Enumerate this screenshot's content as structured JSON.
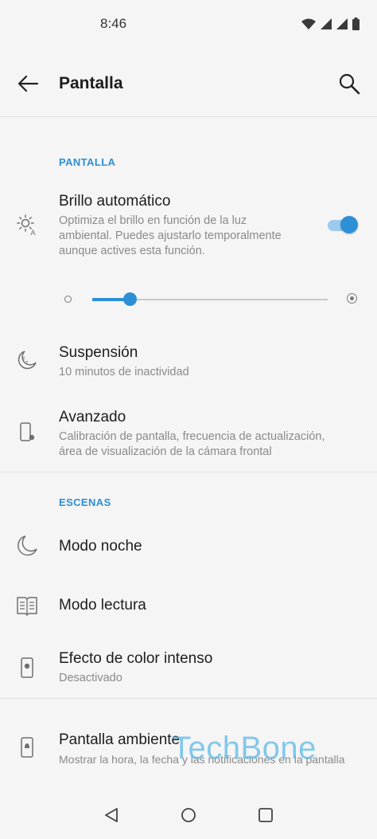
{
  "status": {
    "time": "8:46"
  },
  "header": {
    "title": "Pantalla"
  },
  "sections": {
    "display": "PANTALLA",
    "scenes": "ESCENAS"
  },
  "items": {
    "auto_brightness": {
      "title": "Brillo automático",
      "line1": "Optimiza el brillo en función de la luz",
      "line2": "ambiental. Puedes ajustarlo temporalmente",
      "line3": "aunque actives esta función.",
      "enabled": true
    },
    "brightness_level": 0.16,
    "sleep": {
      "title": "Suspensión",
      "subtitle": "10 minutos de inactividad"
    },
    "advanced": {
      "title": "Avanzado",
      "line1": "Calibración de pantalla, frecuencia de actualización,",
      "line2": "área de visualización de la cámara frontal"
    },
    "night_mode": {
      "title": "Modo noche"
    },
    "reading_mode": {
      "title": "Modo lectura"
    },
    "vivid_color": {
      "title": "Efecto de color intenso",
      "subtitle": "Desactivado"
    },
    "ambient_display": {
      "title": "Pantalla ambiente",
      "subtitle": "Mostrar la hora, la fecha y las notificaciones en la pantalla"
    }
  },
  "watermark": "TechBone",
  "colors": {
    "accent": "#2d8fd6",
    "background": "#f5f5f5"
  }
}
